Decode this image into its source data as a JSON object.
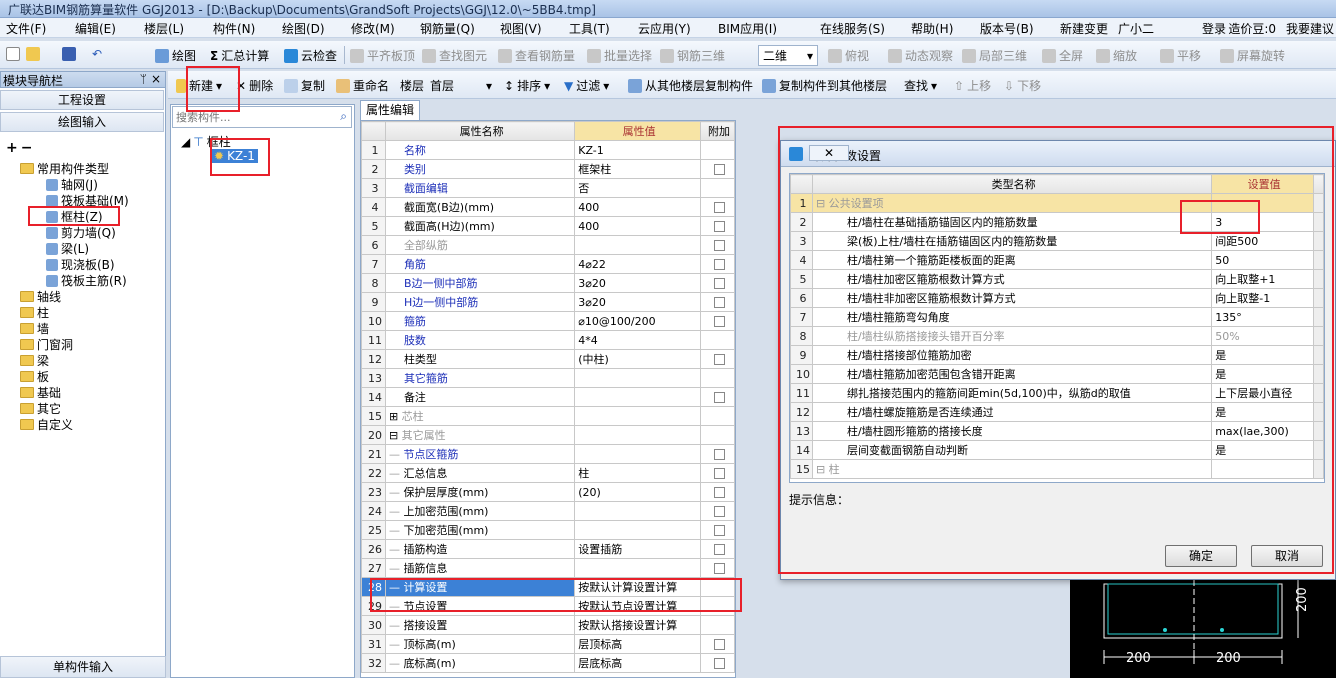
{
  "window": {
    "title": "广联达BIM钢筋算量软件 GGJ2013 - [D:\\Backup\\Documents\\GrandSoft Projects\\GGJ\\12.0\\~5BB4.tmp]"
  },
  "menu": [
    "文件(F)",
    "编辑(E)",
    "楼层(L)",
    "构件(N)",
    "绘图(D)",
    "修改(M)",
    "钢筋量(Q)",
    "视图(V)",
    "工具(T)",
    "云应用(Y)",
    "BIM应用(I)",
    "在线服务(S)",
    "帮助(H)",
    "版本号(B)",
    "新建变更",
    "广小二"
  ],
  "menu_right": {
    "login": "登录",
    "price": "造价豆:0",
    "question": "我要建议"
  },
  "toolbar1": {
    "draw": "绘图",
    "sum": "汇总计算",
    "cloud_check": "云检查",
    "flatten": "平齐板顶",
    "find_elem": "查找图元",
    "view_rebar": "查看钢筋量",
    "batch_select": "批量选择",
    "rebar_3d": "钢筋三维",
    "view_2d": "二维",
    "top_view": "俯视",
    "dyn_view": "动态观察",
    "local_3d": "局部三维",
    "fullscreen": "全屏",
    "zoom": "缩放",
    "pan": "平移",
    "rotate": "屏幕旋转"
  },
  "toolbar2": {
    "new": "新建",
    "delete": "删除",
    "copy": "复制",
    "rename": "重命名",
    "floor_label": "楼层",
    "floor_value": "首层",
    "sort": "排序",
    "filter": "过滤",
    "copy_from": "从其他楼层复制构件",
    "copy_to": "复制构件到其他楼层",
    "find": "查找",
    "move_up": "上移",
    "move_down": "下移"
  },
  "left_panel": {
    "header": "模块导航栏",
    "pin": "ᛘ",
    "close": "×",
    "project_settings": "工程设置",
    "draw_input": "绘图输入",
    "single_input": "单构件输入",
    "common_types": "常用构件类型",
    "common_items": [
      "轴网(J)",
      "筏板基础(M)",
      "框柱(Z)",
      "剪力墙(Q)",
      "梁(L)",
      "现浇板(B)",
      "筏板主筋(R)"
    ],
    "folders": [
      "轴线",
      "柱",
      "墙",
      "门窗洞",
      "梁",
      "板",
      "基础",
      "其它",
      "自定义"
    ]
  },
  "mid_tree": {
    "search_placeholder": "搜索构件...",
    "root": "框柱",
    "child": "KZ-1"
  },
  "prop_tab": "属性编辑",
  "prop_grid": {
    "headers": {
      "name": "属性名称",
      "value": "属性值",
      "extra": "附加"
    },
    "rows": [
      {
        "n": "1",
        "name": "名称",
        "val": "KZ-1",
        "style": "blue",
        "cb": false
      },
      {
        "n": "2",
        "name": "类别",
        "val": "框架柱",
        "style": "blue",
        "cb": true
      },
      {
        "n": "3",
        "name": "截面编辑",
        "val": "否",
        "style": "blue",
        "cb": false
      },
      {
        "n": "4",
        "name": "截面宽(B边)(mm)",
        "val": "400",
        "style": "",
        "cb": true
      },
      {
        "n": "5",
        "name": "截面高(H边)(mm)",
        "val": "400",
        "style": "",
        "cb": true
      },
      {
        "n": "6",
        "name": "全部纵筋",
        "val": "",
        "style": "gray",
        "cb": true
      },
      {
        "n": "7",
        "name": "角筋",
        "val": "4⌀22",
        "style": "blue",
        "cb": true
      },
      {
        "n": "8",
        "name": "B边一侧中部筋",
        "val": "3⌀20",
        "style": "blue",
        "cb": true
      },
      {
        "n": "9",
        "name": "H边一侧中部筋",
        "val": "3⌀20",
        "style": "blue",
        "cb": true
      },
      {
        "n": "10",
        "name": "箍筋",
        "val": "⌀10@100/200",
        "style": "blue",
        "cb": true
      },
      {
        "n": "11",
        "name": "肢数",
        "val": "4*4",
        "style": "blue",
        "cb": false
      },
      {
        "n": "12",
        "name": "柱类型",
        "val": "(中柱)",
        "style": "",
        "cb": true
      },
      {
        "n": "13",
        "name": "其它箍筋",
        "val": "",
        "style": "blue",
        "cb": false
      },
      {
        "n": "14",
        "name": "备注",
        "val": "",
        "style": "",
        "cb": true
      },
      {
        "n": "15",
        "name": "芯柱",
        "val": "",
        "style": "gray",
        "cb": false,
        "group": "plus"
      },
      {
        "n": "20",
        "name": "其它属性",
        "val": "",
        "style": "gray",
        "cb": false,
        "group": "minus"
      },
      {
        "n": "21",
        "name": "节点区箍筋",
        "val": "",
        "style": "blue",
        "cb": true,
        "indent": true
      },
      {
        "n": "22",
        "name": "汇总信息",
        "val": "柱",
        "style": "",
        "cb": true,
        "indent": true
      },
      {
        "n": "23",
        "name": "保护层厚度(mm)",
        "val": "(20)",
        "style": "",
        "cb": true,
        "indent": true
      },
      {
        "n": "24",
        "name": "上加密范围(mm)",
        "val": "",
        "style": "",
        "cb": true,
        "indent": true
      },
      {
        "n": "25",
        "name": "下加密范围(mm)",
        "val": "",
        "style": "",
        "cb": true,
        "indent": true
      },
      {
        "n": "26",
        "name": "插筋构造",
        "val": "设置插筋",
        "style": "",
        "cb": true,
        "indent": true
      },
      {
        "n": "27",
        "name": "插筋信息",
        "val": "",
        "style": "",
        "cb": true,
        "indent": true
      },
      {
        "n": "28",
        "name": "计算设置",
        "val": "按默认计算设置计算",
        "style": "",
        "cb": false,
        "indent": true,
        "selected": true
      },
      {
        "n": "29",
        "name": "节点设置",
        "val": "按默认节点设置计算",
        "style": "",
        "cb": false,
        "indent": true
      },
      {
        "n": "30",
        "name": "搭接设置",
        "val": "按默认搭接设置计算",
        "style": "",
        "cb": false,
        "indent": true
      },
      {
        "n": "31",
        "name": "顶标高(m)",
        "val": "层顶标高",
        "style": "",
        "cb": true,
        "indent": true
      },
      {
        "n": "32",
        "name": "底标高(m)",
        "val": "层底标高",
        "style": "",
        "cb": true,
        "indent": true
      }
    ]
  },
  "dialog": {
    "title": "计算参数设置",
    "headers": {
      "name": "类型名称",
      "value": "设置值"
    },
    "rows": [
      {
        "n": "1",
        "name": "公共设置项",
        "val": "",
        "group": true
      },
      {
        "n": "2",
        "name": "柱/墙柱在基础插筋锚固区内的箍筋数量",
        "val": "3"
      },
      {
        "n": "3",
        "name": "梁(板)上柱/墙柱在插筋锚固区内的箍筋数量",
        "val": "间距500"
      },
      {
        "n": "4",
        "name": "柱/墙柱第一个箍筋距楼板面的距离",
        "val": "50"
      },
      {
        "n": "5",
        "name": "柱/墙柱加密区箍筋根数计算方式",
        "val": "向上取整+1"
      },
      {
        "n": "6",
        "name": "柱/墙柱非加密区箍筋根数计算方式",
        "val": "向上取整-1"
      },
      {
        "n": "7",
        "name": "柱/墙柱箍筋弯勾角度",
        "val": "135°"
      },
      {
        "n": "8",
        "name": "柱/墙柱纵筋搭接接头错开百分率",
        "val": "50%",
        "gray": true
      },
      {
        "n": "9",
        "name": "柱/墙柱搭接部位箍筋加密",
        "val": "是"
      },
      {
        "n": "10",
        "name": "柱/墙柱箍筋加密范围包含错开距离",
        "val": "是"
      },
      {
        "n": "11",
        "name": "绑扎搭接范围内的箍筋间距min(5d,100)中，纵筋d的取值",
        "val": "上下层最小直径"
      },
      {
        "n": "12",
        "name": "柱/墙柱螺旋箍筋是否连续通过",
        "val": "是"
      },
      {
        "n": "13",
        "name": "柱/墙柱圆形箍筋的搭接长度",
        "val": "max(lae,300)"
      },
      {
        "n": "14",
        "name": "层间变截面钢筋自动判断",
        "val": "是"
      },
      {
        "n": "15",
        "name": "柱",
        "val": "",
        "group": true
      }
    ],
    "hint_label": "提示信息：",
    "ok": "确定",
    "cancel": "取消"
  },
  "cad": {
    "dim1": "200",
    "dim2": "200",
    "dim3": "200"
  },
  "colors": {
    "highlight": "#e8202a",
    "selection": "#3c81d6",
    "value_header": "#f7e4a5"
  }
}
